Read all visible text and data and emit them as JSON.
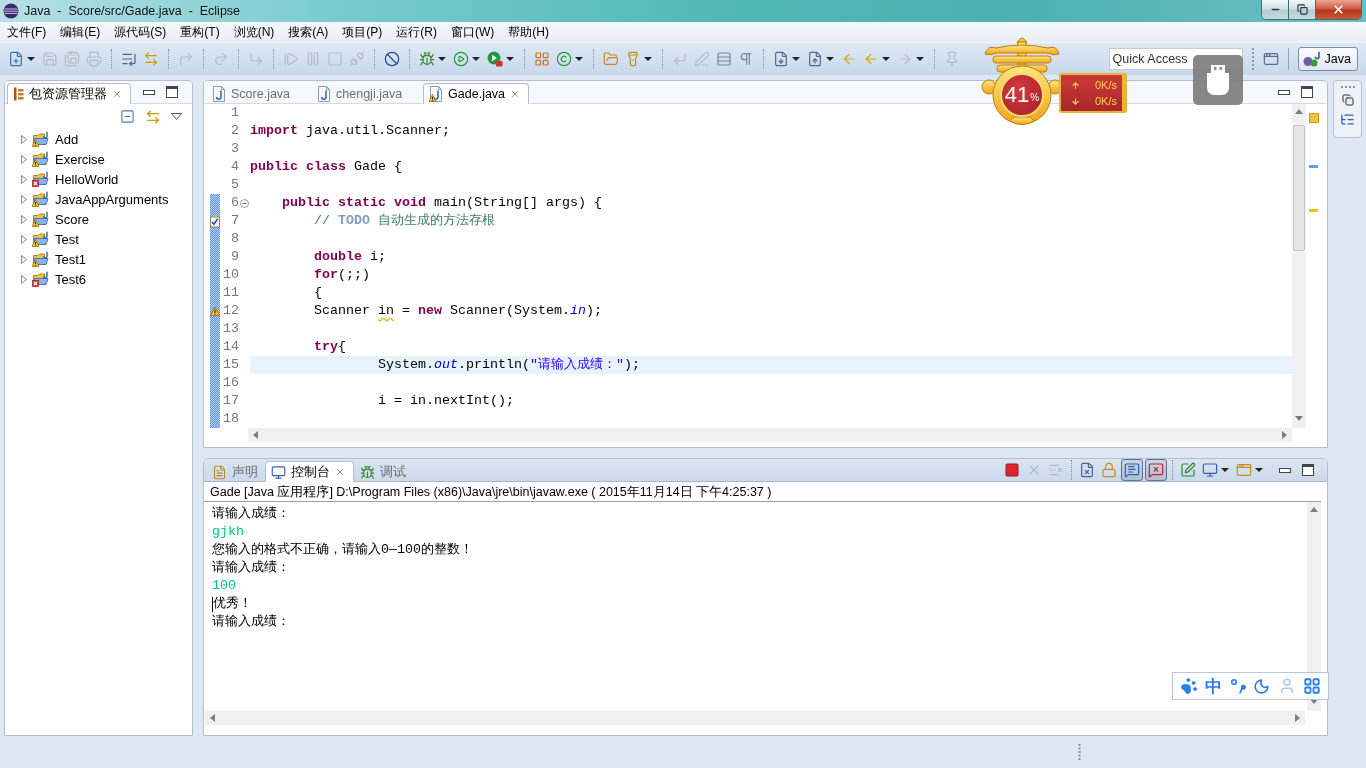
{
  "window": {
    "title": "Java  -  Score/src/Gade.java  -  Eclipse"
  },
  "menu": [
    "文件(F)",
    "编辑(E)",
    "源代码(S)",
    "重构(T)",
    "浏览(N)",
    "搜索(A)",
    "项目(P)",
    "运行(R)",
    "窗口(W)",
    "帮助(H)"
  ],
  "toolbar": [
    [
      {
        "kind": "new",
        "disabled": false,
        "menu": true
      },
      {
        "kind": "save",
        "disabled": true
      },
      {
        "kind": "save_all",
        "disabled": true
      },
      {
        "kind": "print",
        "disabled": true
      }
    ],
    [
      {
        "kind": "format",
        "disabled": false
      },
      {
        "kind": "swap",
        "disabled": false
      }
    ],
    [
      {
        "kind": "step_return",
        "disabled": true
      }
    ],
    [
      {
        "kind": "redo",
        "disabled": true
      }
    ],
    [
      {
        "kind": "step_over",
        "disabled": true
      }
    ],
    [
      {
        "kind": "resume",
        "disabled": true
      },
      {
        "kind": "pause",
        "disabled": true
      },
      {
        "kind": "stop",
        "disabled": true
      },
      {
        "kind": "disconnect",
        "disabled": true
      }
    ],
    [
      {
        "kind": "skip",
        "disabled": false
      }
    ],
    [
      {
        "kind": "debug",
        "disabled": false,
        "menu": true
      },
      {
        "kind": "run",
        "disabled": false,
        "menu": true
      },
      {
        "kind": "external",
        "disabled": false,
        "menu": true
      }
    ],
    [
      {
        "kind": "new_project",
        "disabled": false
      },
      {
        "kind": "new_class",
        "disabled": false,
        "menu": true
      }
    ],
    [
      {
        "kind": "open_type",
        "disabled": false
      },
      {
        "kind": "search",
        "disabled": false,
        "menu": true
      }
    ],
    [
      {
        "kind": "wrap",
        "disabled": true
      },
      {
        "kind": "pen",
        "disabled": true
      },
      {
        "kind": "rows",
        "disabled": false
      },
      {
        "kind": "pilcrow",
        "disabled": false
      }
    ],
    [
      {
        "kind": "next_ann",
        "disabled": false,
        "menu": true
      },
      {
        "kind": "prev_ann",
        "disabled": false,
        "menu": true
      },
      {
        "kind": "last_edit",
        "disabled": false
      },
      {
        "kind": "back",
        "disabled": false,
        "menu": true
      },
      {
        "kind": "forward",
        "disabled": true,
        "menu": true
      }
    ],
    [
      {
        "kind": "pin",
        "disabled": true
      }
    ]
  ],
  "quick_access": {
    "placeholder": "Quick Access"
  },
  "perspective": {
    "label": "Java",
    "selected": true
  },
  "package_explorer": {
    "tabs": [
      {
        "label": "包资源管理器",
        "selected": true
      }
    ],
    "items": [
      {
        "label": "Add",
        "kind": "warning",
        "expanded": false
      },
      {
        "label": "Exercise",
        "kind": "warning",
        "expanded": false
      },
      {
        "label": "HelloWorld",
        "kind": "error",
        "expanded": false
      },
      {
        "label": "JavaAppArguments",
        "kind": "warning",
        "expanded": false
      },
      {
        "label": "Score",
        "kind": "warning",
        "expanded": false
      },
      {
        "label": "Test",
        "kind": "warning",
        "expanded": false
      },
      {
        "label": "Test1",
        "kind": "warning",
        "expanded": false
      },
      {
        "label": "Test6",
        "kind": "error",
        "expanded": false
      }
    ]
  },
  "editor": {
    "tabs": [
      {
        "label": "Score.java",
        "selected": false,
        "warning": false
      },
      {
        "label": "chengji.java",
        "selected": false,
        "warning": false
      },
      {
        "label": "Gade.java",
        "selected": true,
        "warning": true
      }
    ],
    "lines": [
      {
        "number": "1",
        "range": false,
        "current": false
      },
      {
        "number": "2",
        "range": false,
        "current": false,
        "tokens": [
          {
            "text": "import",
            "kind": "keyword"
          },
          {
            "text": " java.util.Scanner;",
            "kind": "plain"
          }
        ]
      },
      {
        "number": "3",
        "range": false,
        "current": false
      },
      {
        "number": "4",
        "range": false,
        "current": false,
        "tokens": [
          {
            "text": "public",
            "kind": "keyword"
          },
          {
            "text": " class",
            "kind": "keyword"
          },
          {
            "text": " Gade {",
            "kind": "plain"
          }
        ]
      },
      {
        "number": "5",
        "range": false,
        "current": false
      },
      {
        "number": "6",
        "range": true,
        "current": false,
        "expanded": true,
        "tokens": [
          {
            "text": "    public",
            "kind": "keyword"
          },
          {
            "text": " static",
            "kind": "keyword"
          },
          {
            "text": " void",
            "kind": "keyword"
          },
          {
            "text": " main(String[] args) {",
            "kind": "plain"
          }
        ]
      },
      {
        "number": "7",
        "range": true,
        "current": false,
        "marker": {
          "kind": "task"
        },
        "tokens": [
          {
            "text": "        // ",
            "kind": "comment"
          },
          {
            "text": "TODO",
            "kind": "task_tag"
          },
          {
            "text": " 自动生成的方法存根",
            "kind": "comment"
          }
        ]
      },
      {
        "number": "8",
        "range": true,
        "current": false
      },
      {
        "number": "9",
        "range": true,
        "current": false,
        "tokens": [
          {
            "text": "        double",
            "kind": "keyword"
          },
          {
            "text": " i;",
            "kind": "plain"
          }
        ]
      },
      {
        "number": "10",
        "range": true,
        "current": false,
        "tokens": [
          {
            "text": "        for",
            "kind": "keyword"
          },
          {
            "text": "(;;)",
            "kind": "plain"
          }
        ]
      },
      {
        "number": "11",
        "range": true,
        "current": false,
        "tokens": [
          {
            "text": "        {",
            "kind": "plain"
          }
        ]
      },
      {
        "number": "12",
        "range": true,
        "current": false,
        "marker": {
          "kind": "warning"
        },
        "tokens": [
          {
            "text": "        Scanner ",
            "kind": "plain"
          },
          {
            "text": "in",
            "kind": "warning"
          },
          {
            "text": " = ",
            "kind": "plain"
          },
          {
            "text": "new",
            "kind": "keyword"
          },
          {
            "text": " Scanner(System.",
            "kind": "plain"
          },
          {
            "text": "in",
            "kind": "field"
          },
          {
            "text": ");",
            "kind": "plain"
          }
        ]
      },
      {
        "number": "13",
        "range": true,
        "current": false
      },
      {
        "number": "14",
        "range": true,
        "current": false,
        "tokens": [
          {
            "text": "        try",
            "kind": "keyword"
          },
          {
            "text": "{",
            "kind": "plain"
          }
        ]
      },
      {
        "number": "15",
        "range": true,
        "current": true,
        "tokens": [
          {
            "text": "                System.",
            "kind": "plain"
          },
          {
            "text": "out",
            "kind": "field"
          },
          {
            "text": ".println(",
            "kind": "plain"
          },
          {
            "text": "\"请输入成绩：\"",
            "kind": "string"
          },
          {
            "text": ");",
            "kind": "plain"
          }
        ]
      },
      {
        "number": "16",
        "range": true,
        "current": false
      },
      {
        "number": "17",
        "range": true,
        "current": false,
        "tokens": [
          {
            "text": "                i = in.nextInt();",
            "kind": "plain"
          }
        ]
      },
      {
        "number": "18",
        "range": true,
        "current": false
      }
    ]
  },
  "console": {
    "tabs": [
      {
        "label": "声明",
        "kind": "declaration",
        "selected": false
      },
      {
        "label": "控制台",
        "kind": "console",
        "selected": true
      },
      {
        "label": "调试",
        "kind": "debug",
        "selected": false
      }
    ],
    "toolbar": [
      [
        {
          "kind": "terminate",
          "disabled": false,
          "pressed": false
        },
        {
          "kind": "remove",
          "disabled": true,
          "pressed": false
        },
        {
          "kind": "remove_all",
          "disabled": true,
          "pressed": false
        }
      ],
      [
        {
          "kind": "clear",
          "disabled": false,
          "pressed": false
        },
        {
          "kind": "scroll_lock",
          "disabled": false,
          "pressed": false
        },
        {
          "kind": "stdout",
          "disabled": false,
          "pressed": true
        },
        {
          "kind": "stderr",
          "disabled": false,
          "pressed": true
        }
      ],
      [
        {
          "kind": "pin",
          "disabled": false,
          "pressed": false
        },
        {
          "kind": "display",
          "disabled": false,
          "pressed": false,
          "menu": true
        },
        {
          "kind": "open",
          "disabled": false,
          "pressed": false,
          "menu": true
        }
      ]
    ],
    "header": "Gade [Java 应用程序] D:\\Program Files (x86)\\Java\\jre\\bin\\javaw.exe ( 2015年11月14日 下午4:25:37 )",
    "output": [
      {
        "text": "请输入成绩：",
        "kind": "output",
        "caret": false
      },
      {
        "text": "gjkh",
        "kind": "input",
        "caret": false
      },
      {
        "text": "您输入的格式不正确，请输入0—100的整数！",
        "kind": "output",
        "caret": false
      },
      {
        "text": "请输入成绩：",
        "kind": "output",
        "caret": false
      },
      {
        "text": "100",
        "kind": "input",
        "caret": false
      },
      {
        "text": "优秀！",
        "kind": "output",
        "caret": true
      },
      {
        "text": "请输入成绩：",
        "kind": "output",
        "caret": false
      }
    ]
  },
  "net_monitor": {
    "percent": "41",
    "unit": "%",
    "upload": "0K/s",
    "download": "0K/s"
  },
  "ime_bar": {
    "mode": "中"
  }
}
